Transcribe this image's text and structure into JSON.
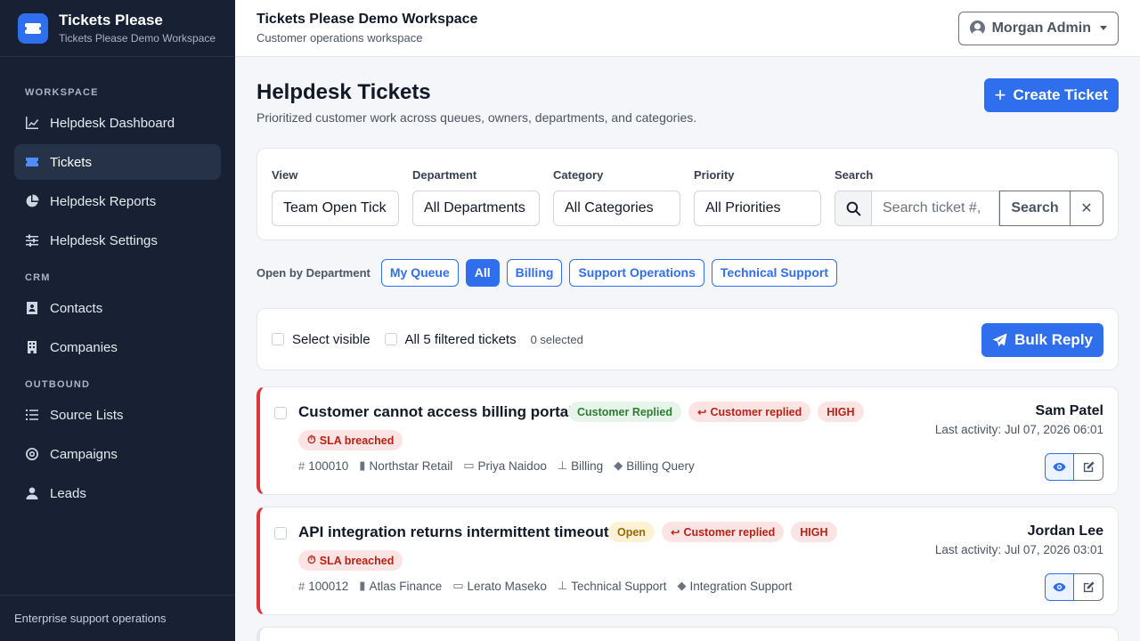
{
  "brand": {
    "title": "Tickets Please",
    "subtitle": "Tickets Please Demo Workspace"
  },
  "sidebar": {
    "sections": [
      {
        "label": "WORKSPACE"
      },
      {
        "label": "CRM"
      },
      {
        "label": "OUTBOUND"
      }
    ],
    "items": [
      {
        "label": "Helpdesk Dashboard",
        "icon": "chart-line-icon"
      },
      {
        "label": "Tickets",
        "icon": "ticket-icon",
        "active": true
      },
      {
        "label": "Helpdesk Reports",
        "icon": "pie-chart-icon"
      },
      {
        "label": "Helpdesk Settings",
        "icon": "sliders-icon"
      },
      {
        "label": "Contacts",
        "icon": "address-book-icon"
      },
      {
        "label": "Companies",
        "icon": "building-icon"
      },
      {
        "label": "Source Lists",
        "icon": "list-icon"
      },
      {
        "label": "Campaigns",
        "icon": "target-icon"
      },
      {
        "label": "Leads",
        "icon": "user-icon"
      }
    ],
    "footer": "Enterprise support operations"
  },
  "topbar": {
    "title": "Tickets Please Demo Workspace",
    "subtitle": "Customer operations workspace",
    "user": "Morgan Admin"
  },
  "page": {
    "title": "Helpdesk Tickets",
    "description": "Prioritized customer work across queues, owners, departments, and categories.",
    "create_label": "Create Ticket"
  },
  "filters": {
    "view": {
      "label": "View",
      "value": "Team Open Tick"
    },
    "department": {
      "label": "Department",
      "value": "All Departments"
    },
    "category": {
      "label": "Category",
      "value": "All Categories"
    },
    "priority": {
      "label": "Priority",
      "value": "All Priorities"
    },
    "search": {
      "label": "Search",
      "placeholder": "Search ticket #,",
      "button": "Search",
      "clear": "✕"
    }
  },
  "departments": {
    "label": "Open by Department",
    "pills": [
      "My Queue",
      "All",
      "Billing",
      "Support Operations",
      "Technical Support"
    ],
    "active": "All"
  },
  "bulk": {
    "select_visible": "Select visible",
    "select_all": "All 5 filtered tickets",
    "selected": "0 selected",
    "reply_label": "Bulk Reply"
  },
  "tickets": [
    {
      "title": "Customer cannot access billing portal",
      "status": "Customer Replied",
      "status_color": "green",
      "reply": "Customer replied",
      "priority": "HIGH",
      "sla": "SLA breached",
      "id": "100010",
      "company": "Northstar Retail",
      "contact": "Priya Naidoo",
      "department": "Billing",
      "category": "Billing Query",
      "owner": "Sam Patel",
      "activity": "Last activity: Jul 07, 2026 06:01"
    },
    {
      "title": "API integration returns intermittent timeout",
      "status": "Open",
      "status_color": "yellow",
      "reply": "Customer replied",
      "priority": "HIGH",
      "sla": "SLA breached",
      "id": "100012",
      "company": "Atlas Finance",
      "contact": "Lerato Maseko",
      "department": "Technical Support",
      "category": "Integration Support",
      "owner": "Jordan Lee",
      "activity": "Last activity: Jul 07, 2026 03:01"
    }
  ]
}
